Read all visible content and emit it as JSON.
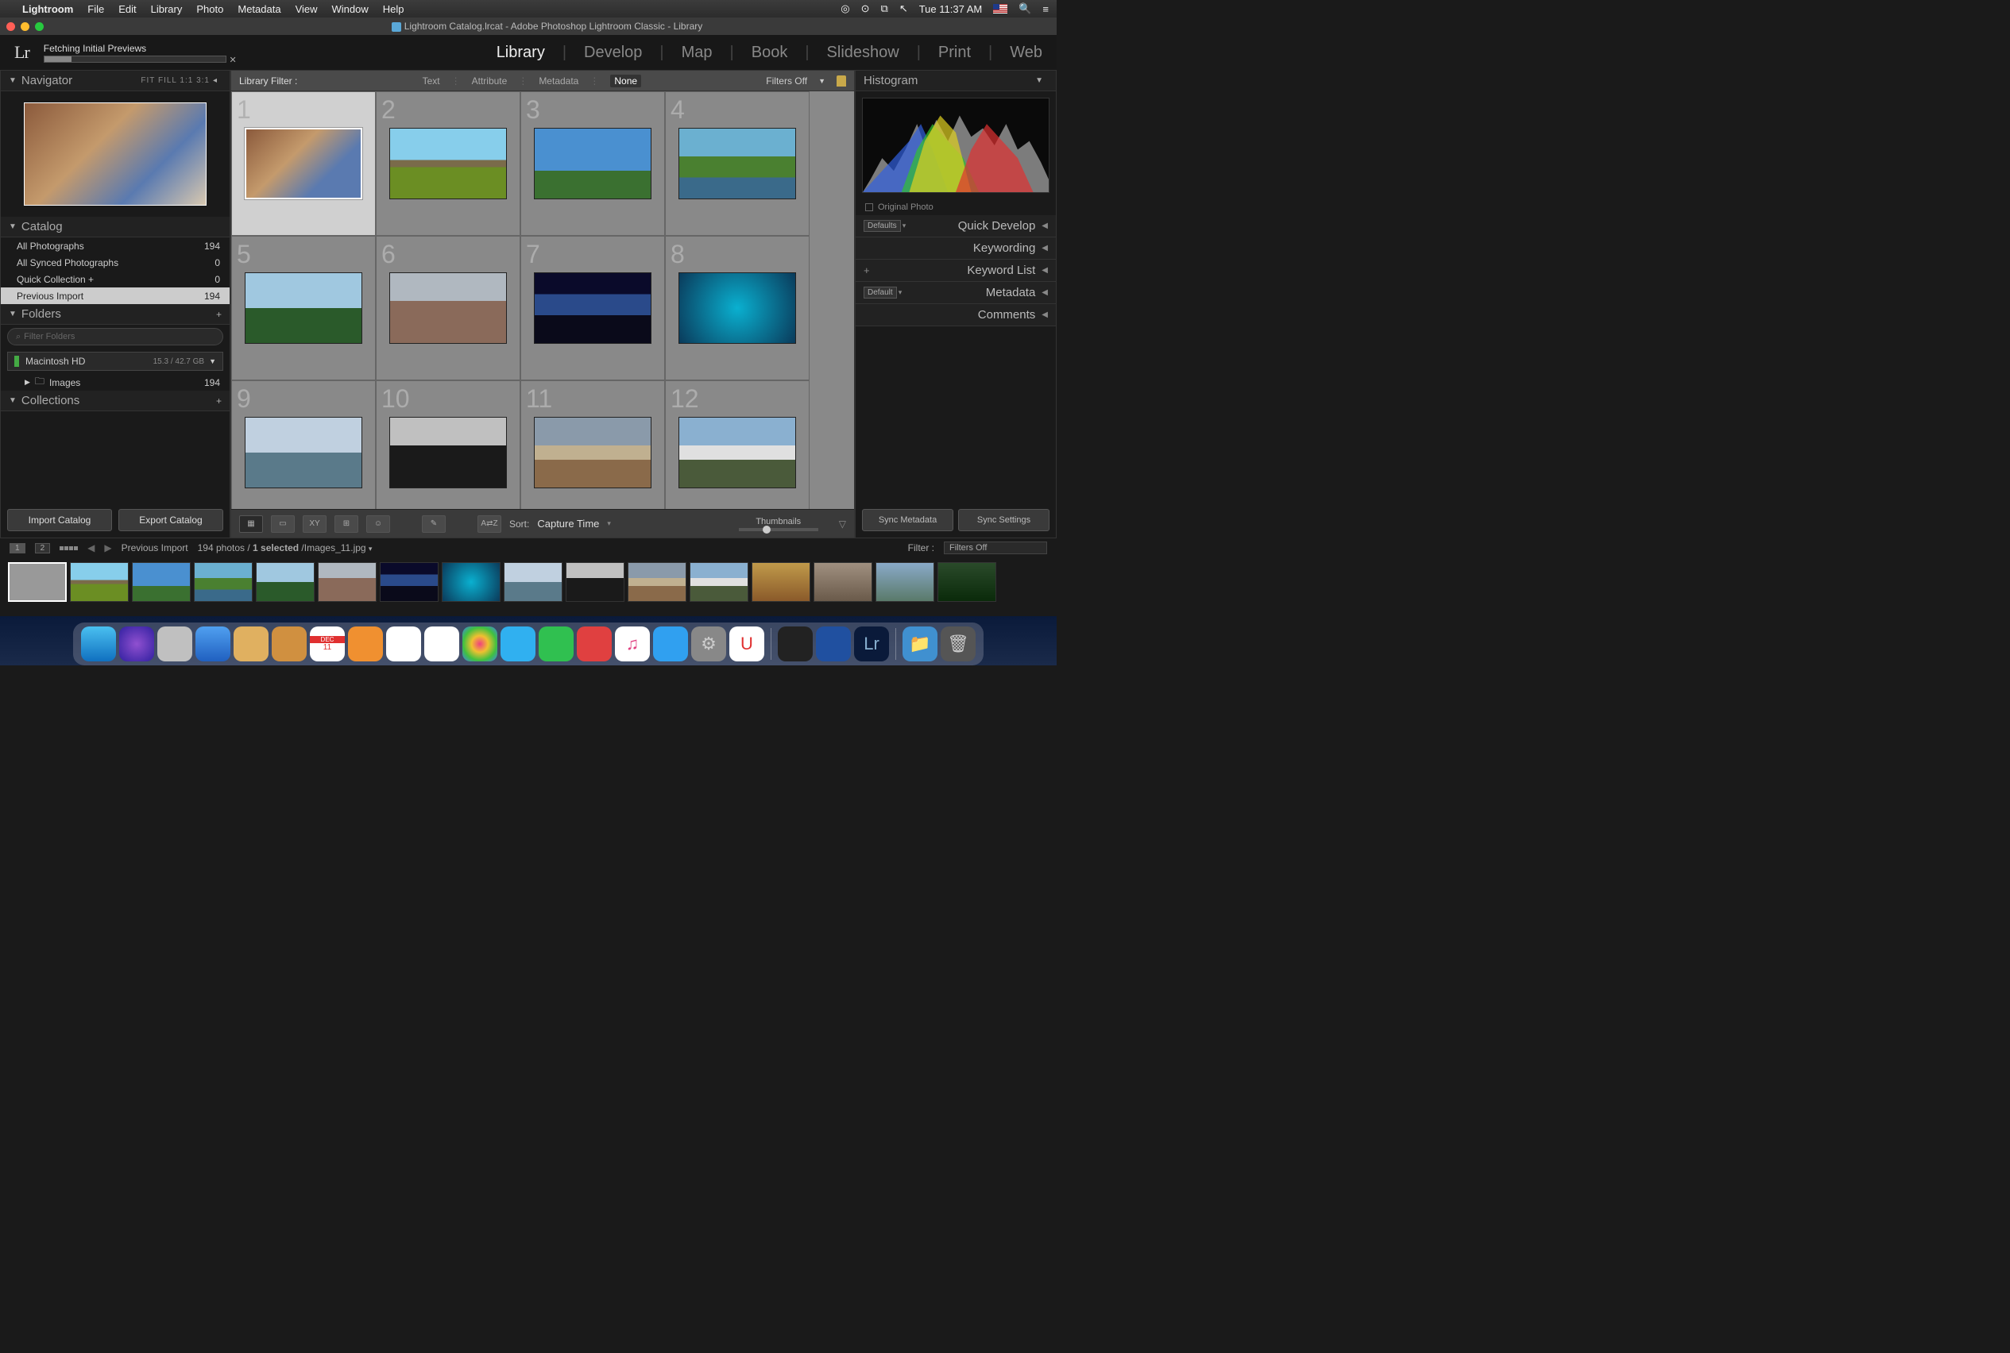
{
  "menubar": {
    "app": "Lightroom",
    "items": [
      "File",
      "Edit",
      "Library",
      "Photo",
      "Metadata",
      "View",
      "Window",
      "Help"
    ],
    "clock": "Tue 11:37 AM"
  },
  "window": {
    "title": "Lightroom Catalog.lrcat - Adobe Photoshop Lightroom Classic - Library"
  },
  "status": {
    "text": "Fetching Initial Previews"
  },
  "modules": [
    "Library",
    "Develop",
    "Map",
    "Book",
    "Slideshow",
    "Print",
    "Web"
  ],
  "active_module": "Library",
  "navigator": {
    "title": "Navigator",
    "opts": "FIT   FILL   1:1   3:1"
  },
  "catalog": {
    "title": "Catalog",
    "rows": [
      {
        "label": "All Photographs",
        "count": "194"
      },
      {
        "label": "All Synced Photographs",
        "count": "0"
      },
      {
        "label": "Quick Collection  +",
        "count": "0"
      },
      {
        "label": "Previous Import",
        "count": "194",
        "selected": true
      }
    ]
  },
  "folders": {
    "title": "Folders",
    "filter_placeholder": "Filter Folders",
    "volume": "Macintosh HD",
    "volume_size": "15.3 / 42.7 GB",
    "items": [
      {
        "label": "Images",
        "count": "194"
      }
    ]
  },
  "collections": {
    "title": "Collections"
  },
  "left_buttons": {
    "import": "Import Catalog",
    "export": "Export Catalog"
  },
  "filter_bar": {
    "label": "Library Filter :",
    "tabs": [
      "Text",
      "Attribute",
      "Metadata",
      "None"
    ],
    "active": "None",
    "filters_off": "Filters Off"
  },
  "grid": {
    "cells": [
      1,
      2,
      3,
      4,
      5,
      6,
      7,
      8,
      9,
      10,
      11,
      12
    ],
    "selected": 1
  },
  "toolbar": {
    "sort_label": "Sort:",
    "sort_value": "Capture Time",
    "thumbnails": "Thumbnails"
  },
  "right": {
    "histogram": "Histogram",
    "original": "Original Photo",
    "defaults_dd": "Defaults",
    "default_dd": "Default",
    "panels": [
      "Quick Develop",
      "Keywording",
      "Keyword List",
      "Metadata",
      "Comments"
    ],
    "sync_meta": "Sync Metadata",
    "sync_settings": "Sync Settings"
  },
  "filmstrip": {
    "pages": [
      "1",
      "2"
    ],
    "breadcrumb": "Previous Import",
    "info": "194 photos /",
    "selected": "1 selected",
    "file": " /Images_11.jpg",
    "filter_label": "Filter :",
    "filter_value": "Filters Off"
  },
  "dock": [
    "finder",
    "siri",
    "launchpad",
    "safari",
    "mail",
    "contacts",
    "calendar",
    "reminders",
    "notes",
    "maps",
    "photos",
    "messages",
    "facetime",
    "news",
    "itunes",
    "appstore",
    "prefs",
    "magnet",
    "terminal",
    "1password",
    "lightroom",
    "downloads",
    "trash"
  ]
}
